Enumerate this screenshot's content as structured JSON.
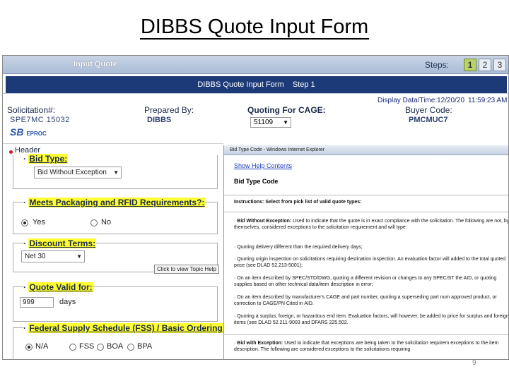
{
  "slide": {
    "title": "DIBBS Quote Input Form",
    "page_number": "9"
  },
  "topbar": {
    "title": "Input Quote",
    "steps_label": "Steps:",
    "steps": [
      "1",
      "2",
      "3"
    ],
    "active_step": "1"
  },
  "form_bar": {
    "title": "DIBBS Quote Input Form    Step 1"
  },
  "info": {
    "solicitation_label": "Solicitation#:",
    "solicitation_value": "SPE7MC   15032",
    "prepared_by_label": "Prepared By:",
    "prepared_by_value": "DIBBS",
    "quoting_for_label": "Quoting For CAGE:",
    "cage_value": "51109",
    "display_datetime": "Display Data/Time:12/20/20",
    "time_value": "11:59:23 AM",
    "buyer_code_label": "Buyer Code:",
    "buyer_code_value": "PMCMUC7",
    "logo_text": "SB",
    "logo_sub": "EPROC"
  },
  "form": {
    "header_label": "Header",
    "bid_type_label": "Bid Type:",
    "bid_type_value": "Bid Without Exception",
    "packaging_label": "Meets Packaging and RFID Requirements?:",
    "packaging_yes": "Yes",
    "packaging_no": "No",
    "discount_label": "Discount Terms:",
    "discount_value": "Net 30",
    "quote_valid_label": "Quote Valid for:",
    "quote_valid_value": "999",
    "quote_valid_unit": "days",
    "fss_label": "Federal Supply Schedule (FSS) / Basic Ordering Agr",
    "fss_options": [
      "N/A",
      "FSS",
      "BOA",
      "BPA"
    ]
  },
  "tooltip": "Click to view Topic Help",
  "help_window": {
    "titlebar": "Bid Type Code - Windows Internet Explorer",
    "show_help": "Show Help Contents",
    "title": "Bid Type Code",
    "instructions": "Instructions: Select from pick list of valid quote types:",
    "bwe_head": "Bid Without Exception:",
    "bwe_text": "Used to indicate that the quote is in exact compliance with the solicitation. The following are not, by themselves, considered exceptions to the solicitation requirement and will type:",
    "bullet1": "Quoting delivery different than the required delivery days;",
    "bullet2": "Quoting origin inspection on solicitations requiring destination inspection. An evaluation factor will added to the total quoted price (see DLAD 52.213-5001);",
    "bullet3": "On an item described by SPEC/STD/DWG, quoting a different revision or changes to any SPEC/ST the AID, or quoting supplies based on other technical data/item description in error;",
    "bullet4": "On an item described by manufacturer's CAGE and part number, quoting a superseding part num approved product, or correction to CAGE/PN Cited in AID.",
    "bullet5": "Quoting a surplus, foreign, or hazardous end item. Evaluation factors, will however, be added to price for surplus and foreign items (see DLAD 52.211-9003 and DFARS 225.502.",
    "bwex_head": "Bid with Exception:",
    "bwex_text": "Used to indicate that exceptions are being taken to the solicitation requirem exceptions to the item description. The following are considered exceptions to the solicitations requiring"
  }
}
